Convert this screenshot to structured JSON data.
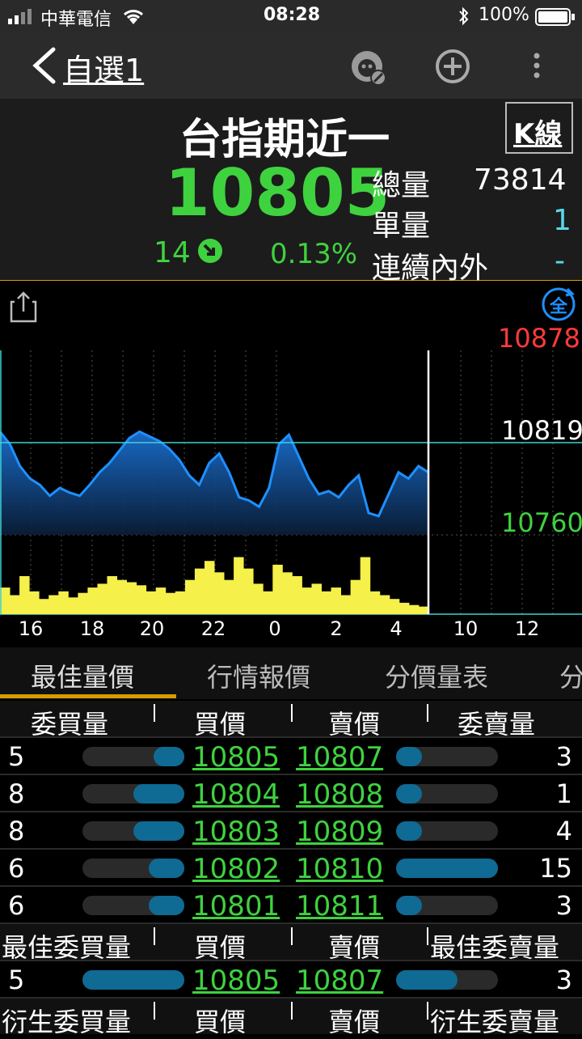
{
  "status": {
    "carrier": "中華電信",
    "time": "08:28",
    "battery": "100%"
  },
  "nav": {
    "back_label": "自選1",
    "icons": [
      "watchlist-face-icon",
      "add-circle-icon",
      "more-vertical-icon"
    ]
  },
  "quote": {
    "name": "台指期近一",
    "k_button": "K線",
    "price": "10805",
    "change": "14",
    "change_pct": "0.13%",
    "total_vol_label": "總量",
    "total_vol": "73814",
    "single_vol_label": "單量",
    "single_vol": "1",
    "cont_label": "連續內外",
    "cont_value": "-"
  },
  "chart": {
    "high_label": "10878",
    "mid_label": "10819",
    "low_label": "10760",
    "x_ticks": [
      "16",
      "18",
      "20",
      "22",
      "0",
      "2",
      "4",
      "10",
      "12"
    ],
    "toggle_label": "全",
    "colors": {
      "price_line": "#1e90ff",
      "volume": "#f5f04a",
      "ref_line": "#3ed1d1"
    }
  },
  "chart_data": {
    "type": "area",
    "y_range": [
      10760,
      10878
    ],
    "reference": 10819,
    "x_ticks": [
      "16",
      "18",
      "20",
      "22",
      "0",
      "2",
      "4",
      "10",
      "12"
    ],
    "price_series": [
      10826,
      10818,
      10804,
      10796,
      10792,
      10785,
      10790,
      10787,
      10785,
      10792,
      10800,
      10806,
      10814,
      10822,
      10826,
      10823,
      10820,
      10815,
      10808,
      10798,
      10792,
      10806,
      10812,
      10800,
      10784,
      10782,
      10778,
      10790,
      10818,
      10824,
      10810,
      10796,
      10786,
      10788,
      10784,
      10792,
      10798,
      10774,
      10772,
      10786,
      10800,
      10796,
      10804,
      10800
    ],
    "volume_series": [
      0.35,
      0.25,
      0.5,
      0.3,
      0.2,
      0.25,
      0.3,
      0.22,
      0.28,
      0.35,
      0.4,
      0.5,
      0.45,
      0.42,
      0.38,
      0.3,
      0.35,
      0.28,
      0.3,
      0.45,
      0.6,
      0.7,
      0.55,
      0.45,
      0.75,
      0.6,
      0.4,
      0.3,
      0.65,
      0.55,
      0.5,
      0.35,
      0.4,
      0.3,
      0.35,
      0.25,
      0.45,
      0.75,
      0.3,
      0.25,
      0.2,
      0.15,
      0.12,
      0.1
    ]
  },
  "tabs": [
    "最佳量價",
    "行情報價",
    "分價量表",
    "分"
  ],
  "orderbook": {
    "headers": [
      "委買量",
      "買價",
      "賣價",
      "委賣量"
    ],
    "rows": [
      {
        "bid_qty": "5",
        "bid": "10805",
        "ask": "10807",
        "ask_qty": "3",
        "bid_fill": 0.3,
        "ask_fill": 0.25
      },
      {
        "bid_qty": "8",
        "bid": "10804",
        "ask": "10808",
        "ask_qty": "1",
        "bid_fill": 0.5,
        "ask_fill": 0.25
      },
      {
        "bid_qty": "8",
        "bid": "10803",
        "ask": "10809",
        "ask_qty": "4",
        "bid_fill": 0.5,
        "ask_fill": 0.25
      },
      {
        "bid_qty": "6",
        "bid": "10802",
        "ask": "10810",
        "ask_qty": "15",
        "bid_fill": 0.35,
        "ask_fill": 1.0
      },
      {
        "bid_qty": "6",
        "bid": "10801",
        "ask": "10811",
        "ask_qty": "3",
        "bid_fill": 0.35,
        "ask_fill": 0.25
      }
    ],
    "best_headers": [
      "最佳委買量",
      "買價",
      "賣價",
      "最佳委賣量"
    ],
    "best_row": {
      "bid_qty": "5",
      "bid": "10805",
      "ask": "10807",
      "ask_qty": "3",
      "bid_fill": 1.0,
      "ask_fill": 0.6
    },
    "deriv_headers": [
      "衍生委買量",
      "買價",
      "賣價",
      "衍生委賣量"
    ]
  }
}
